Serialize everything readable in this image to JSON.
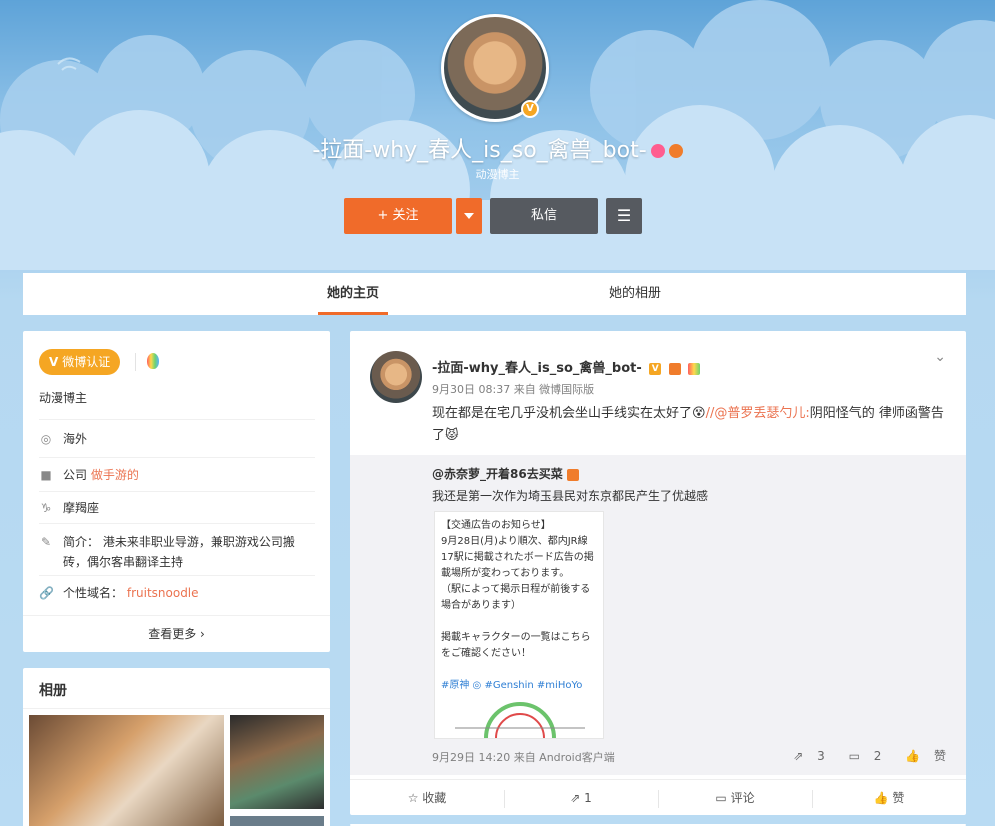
{
  "profile": {
    "name": "-拉面-why_春人_is_so_禽兽_bot-",
    "description": "动漫博主",
    "follow_label": "+ 关注",
    "message_label": "私信"
  },
  "tabs": [
    {
      "label": "她的主页"
    },
    {
      "label": "她的相册"
    }
  ],
  "left_panel": {
    "verify_label": "微博认证",
    "verify_text": "动漫博主",
    "rows": [
      {
        "icon": "location-icon",
        "label": "海外"
      },
      {
        "icon": "company-icon",
        "label": "公司",
        "value": "做手游的"
      },
      {
        "icon": "zodiac-icon",
        "label": "摩羯座"
      },
      {
        "icon": "bio-icon",
        "label": "简介： 港未来非职业导游，兼职游戏公司搬砖，偶尔客串翻译主持"
      },
      {
        "icon": "link-icon",
        "label": "个性域名：",
        "value": "fruitsnoodle"
      }
    ],
    "more_label": "查看更多 ›"
  },
  "album": {
    "title": "相册"
  },
  "post": {
    "author": "-拉面-why_春人_is_so_禽兽_bot-",
    "meta": "9月30日 08:37 来自 微博国际版",
    "text_pre": "现在都是在宅几乎没机会坐山手线实在太好了",
    "mention": "//@普罗丢瑟勺儿:",
    "text_post": "阴阳怪气的 律师函警告了",
    "repost": {
      "author": "@赤奈萝_开着86去买菜",
      "text": "我还是第一次作为埼玉县民对东京都民产生了优越感",
      "image_lines": [
        "【交通広告のお知らせ】",
        "9月28日(月)より順次、都内JR線",
        "17駅に掲載されたボード広告の掲",
        "載場所が変わっております。",
        "（駅によって掲示日程が前後する",
        "場合があります）",
        "",
        "掲載キャラクターの一覧はこちら",
        "をご確認ください！",
        "",
        "#原神 ◎ #Genshin #miHoYo"
      ],
      "meta": "9月29日 14:20 来自 Android客户端",
      "reposts": "3",
      "comments": "2",
      "likes": "赞"
    },
    "actions": {
      "favorite": "收藏",
      "repost": "1",
      "comment": "评论",
      "like": "赞"
    }
  },
  "colors": {
    "accent": "#f06b2a",
    "link": "#eb7350",
    "dark_btn": "#565a60"
  }
}
